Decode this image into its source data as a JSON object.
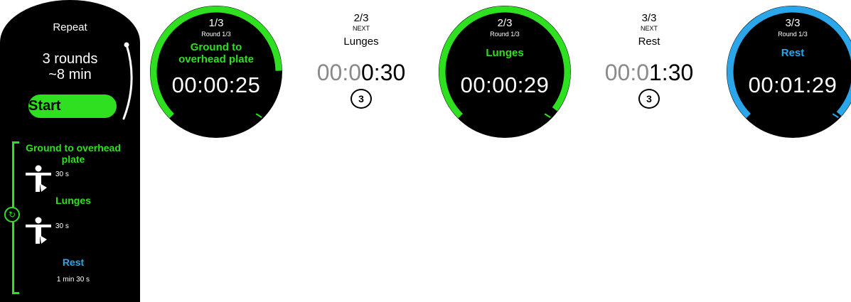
{
  "colors": {
    "green": "#2ee01f",
    "blue": "#2aa7ea",
    "background": "#000000"
  },
  "panel": {
    "repeat_label": "Repeat",
    "rounds": "3 rounds",
    "duration": "~8 min",
    "start_label": "Start",
    "loop_icon": "repeat-icon",
    "exercises": [
      {
        "name": "Ground to overhead plate",
        "duration": "30 s",
        "icon": "exercise-figure-icon"
      },
      {
        "name": "Lunges",
        "duration": "30 s",
        "icon": "exercise-figure-icon"
      },
      {
        "name": "Rest",
        "duration": "1 min 30 s"
      }
    ]
  },
  "screens": [
    {
      "type": "active",
      "index": "1/3",
      "round": "Round 1/3",
      "name": "Ground to overhead plate",
      "time": "00:00:25",
      "color": "#2ee01f",
      "progress": 0.83
    },
    {
      "type": "next",
      "index": "2/3",
      "label": "NEXT",
      "name": "Lunges",
      "time_dim": "00:0",
      "time_bright": "0:30",
      "countdown": "3"
    },
    {
      "type": "active",
      "index": "2/3",
      "round": "Round 1/3",
      "name": "Lunges",
      "time": "00:00:29",
      "color": "#2ee01f",
      "progress": 0.97
    },
    {
      "type": "next",
      "index": "3/3",
      "label": "NEXT",
      "name": "Rest",
      "time_dim": "00:0",
      "time_bright": "1:30",
      "countdown": "3"
    },
    {
      "type": "active",
      "index": "3/3",
      "round": "Round 1/3",
      "name": "Rest",
      "time": "00:01:29",
      "color": "#2aa7ea",
      "progress": 0.99
    }
  ]
}
